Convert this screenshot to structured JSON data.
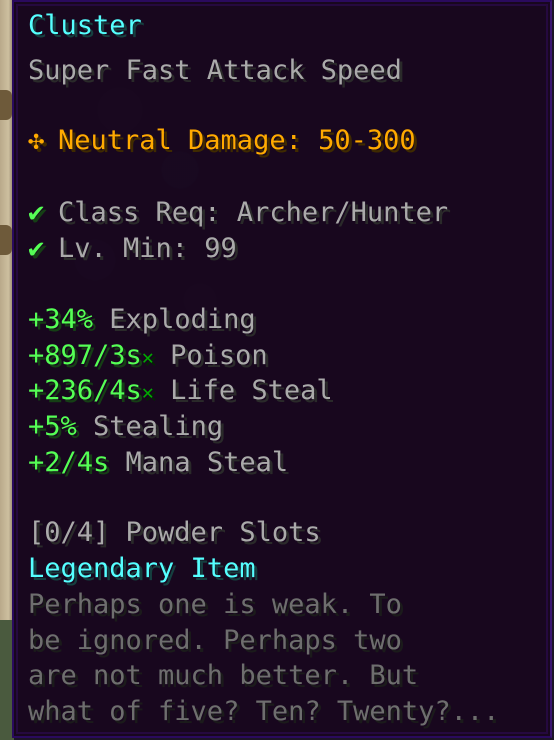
{
  "item": {
    "name": "Cluster",
    "attack_speed": "Super Fast Attack Speed",
    "damage": {
      "icon": "✣",
      "text": "Neutral Damage: 50-300"
    },
    "requirements": [
      {
        "icon": "✔",
        "text": "Class Req: Archer/Hunter"
      },
      {
        "icon": "✔",
        "text": "Lv. Min: 99"
      }
    ],
    "identifications": [
      {
        "value": "+34%",
        "suffix": "",
        "name": "Exploding"
      },
      {
        "value": "+897/3s",
        "suffix": "✕",
        "name": "Poison"
      },
      {
        "value": "+236/4s",
        "suffix": "✕",
        "name": "Life Steal"
      },
      {
        "value": "+5%",
        "suffix": "",
        "name": "Stealing"
      },
      {
        "value": "+2/4s",
        "suffix": "",
        "name": "Mana Steal"
      }
    ],
    "powder_slots": "[0/4] Powder Slots",
    "rarity": "Legendary Item",
    "lore": [
      "Perhaps one is weak. To",
      "be ignored. Perhaps two",
      "are not much better. But",
      "what of five? Ten? Twenty?..."
    ]
  },
  "colors": {
    "name": "#55ffff",
    "tier": "#55ffff",
    "damage": "#ffaa00",
    "check": "#55ff55",
    "id_value": "#55ff55",
    "id_name": "#aaaaaa",
    "lore": "#6e6e6e"
  }
}
